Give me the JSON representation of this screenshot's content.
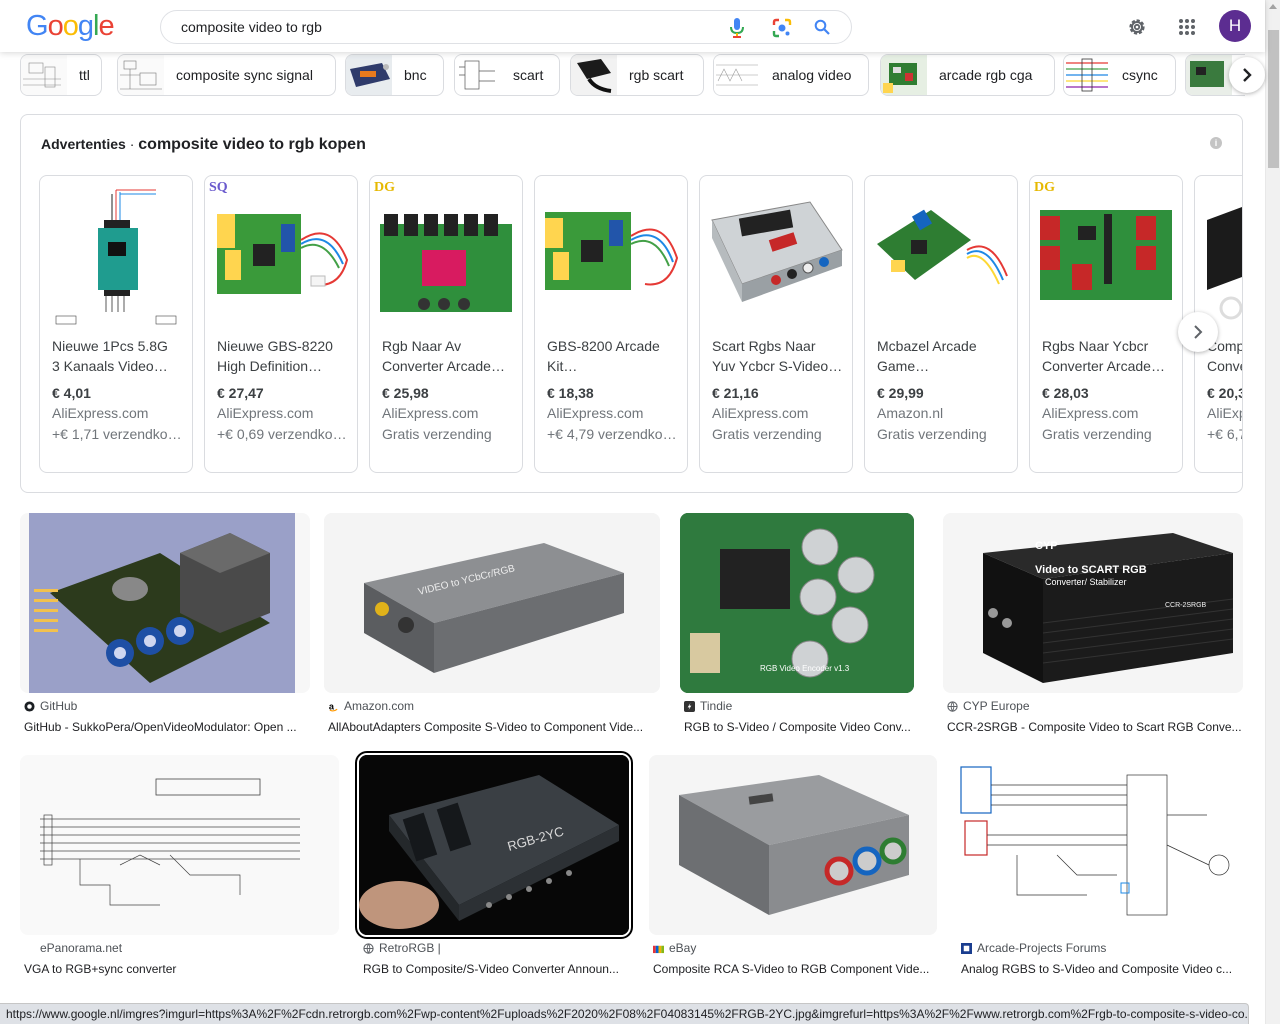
{
  "search": {
    "query": "composite video to rgb"
  },
  "logo": {
    "letters": [
      "G",
      "o",
      "o",
      "g",
      "l",
      "e"
    ],
    "colors": [
      "#4285f4",
      "#ea4335",
      "#fbbc05",
      "#4285f4",
      "#34a853",
      "#ea4335"
    ]
  },
  "account": {
    "initial": "H",
    "color": "#5c2d91"
  },
  "chips": [
    {
      "label": "ttl"
    },
    {
      "label": "composite sync signal"
    },
    {
      "label": "bnc"
    },
    {
      "label": "scart"
    },
    {
      "label": "rgb scart"
    },
    {
      "label": "analog video"
    },
    {
      "label": "arcade rgb cga"
    },
    {
      "label": "csync"
    }
  ],
  "ads": {
    "label": "Advertenties",
    "separator": "·",
    "query_title": "composite video to rgb kopen",
    "items": [
      {
        "name1": "Nieuwe 1Pcs 5.8G",
        "name2": "3 Kanaals Video…",
        "price": "€ 4,01",
        "store": "AliExpress.com",
        "shipping": "+€ 1,71 verzendko…",
        "badge": ""
      },
      {
        "name1": "Nieuwe GBS-8220",
        "name2": "High Definition…",
        "price": "€ 27,47",
        "store": "AliExpress.com",
        "shipping": "+€ 0,69 verzendko…",
        "badge": "SQ"
      },
      {
        "name1": "Rgb Naar Av",
        "name2": "Converter Arcade…",
        "price": "€ 25,98",
        "store": "AliExpress.com",
        "shipping": "Gratis verzending",
        "badge": "DG"
      },
      {
        "name1": "GBS-8200 Arcade",
        "name2": "Kit…",
        "price": "€ 18,38",
        "store": "AliExpress.com",
        "shipping": "+€ 4,79 verzendko…",
        "badge": ""
      },
      {
        "name1": "Scart Rgbs Naar",
        "name2": "Yuv Ycbcr S-Video…",
        "price": "€ 21,16",
        "store": "AliExpress.com",
        "shipping": "Gratis verzending",
        "badge": ""
      },
      {
        "name1": "Mcbazel Arcade",
        "name2": "Game…",
        "price": "€ 29,99",
        "store": "Amazon.nl",
        "shipping": "Gratis verzending",
        "badge": ""
      },
      {
        "name1": "Rgbs Naar Ycbcr",
        "name2": "Converter Arcade…",
        "price": "€ 28,03",
        "store": "AliExpress.com",
        "shipping": "Gratis verzending",
        "badge": "DG"
      },
      {
        "name1": "Comp",
        "name2": "Conve",
        "price": "€ 20,3",
        "store": "AliExp",
        "shipping": "+€ 6,7",
        "badge": ""
      }
    ]
  },
  "results": [
    {
      "source": "GitHub",
      "title": "GitHub - SukkoPera/OpenVideoModulator: Open ..."
    },
    {
      "source": "Amazon.com",
      "title": "AllAboutAdapters Composite S-Video to Component Vide..."
    },
    {
      "source": "Tindie",
      "title": "RGB to S-Video / Composite Video Conv..."
    },
    {
      "source": "CYP Europe",
      "title": "CCR-2SRGB - Composite Video to Scart RGB Conve..."
    },
    {
      "source": "ePanorama.net",
      "title": "VGA to RGB+sync converter"
    },
    {
      "source": "RetroRGB |",
      "title": "RGB to Composite/S-Video Converter Announ..."
    },
    {
      "source": "eBay",
      "title": "Composite RCA S-Video to RGB Component Vide..."
    },
    {
      "source": "Arcade-Projects Forums",
      "title": "Analog RGBS to S-Video and Composite Video c..."
    }
  ],
  "image_text": {
    "cyp_brand": "CYP",
    "cyp_product": "Video to SCART RGB",
    "cyp_sub": "Converter/ Stabilizer",
    "cyp_model": "CCR-2SRGB",
    "rgb2yc": "RGB-2YC",
    "amazon_label": "VIDEO to YCbCr/RGB",
    "tindie_label": "RGB Video Encoder v1.3"
  },
  "status_url": "https://www.google.nl/imgres?imgurl=https%3A%2F%2Fcdn.retrorgb.com%2Fwp-content%2Fuploads%2F2020%2F08%2F04083145%2FRGB-2YC.jpg&imgrefurl=https%3A%2F%2Fwww.retrorgb.com%2Frgb-to-composite-s-video-co..."
}
